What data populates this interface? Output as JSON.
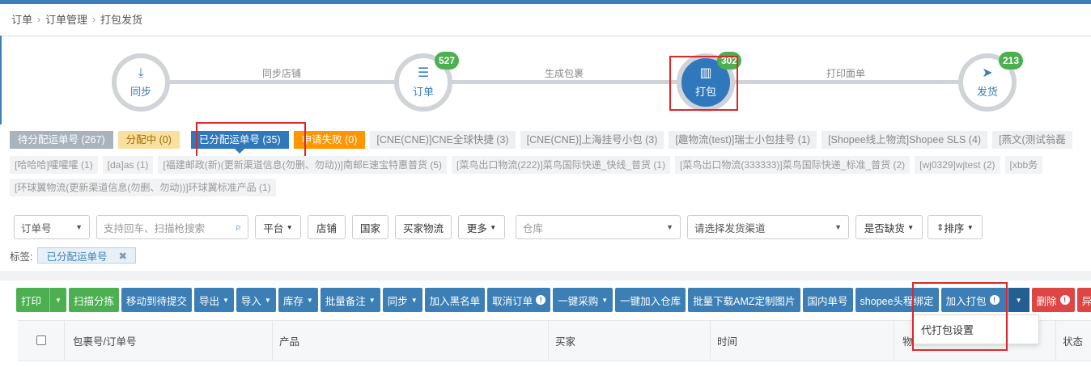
{
  "breadcrumb": [
    "订单",
    "订单管理",
    "打包发货"
  ],
  "steps": [
    {
      "label": "同步",
      "icon": "download-icon",
      "badge": ""
    },
    {
      "label": "订单",
      "icon": "list-icon",
      "badge": "527"
    },
    {
      "label": "打包",
      "icon": "barcode-icon",
      "badge": "302"
    },
    {
      "label": "发货",
      "icon": "paper-plane-icon",
      "badge": "213"
    }
  ],
  "step_connectors": [
    "同步店铺",
    "生成包裹",
    "打印面单"
  ],
  "status_tabs": [
    {
      "label": "待分配运单号 (267)",
      "style": "grey"
    },
    {
      "label": "分配中 (0)",
      "style": "yellow"
    },
    {
      "label": "已分配运单号 (35)",
      "style": "blue"
    },
    {
      "label": "申请失败 (0)",
      "style": "orange"
    }
  ],
  "channel_tags_row1": [
    "[CNE(CNE)]CNE全球快捷 (3)",
    "[CNE(CNE)]上海挂号小包 (3)",
    "[趣物流(test)]瑞士小包挂号 (1)",
    "[Shopee线上物流]Shopee SLS (4)",
    "[燕文(测试翁磊"
  ],
  "channel_tags_row2": [
    "[哈哈哈]嚯嚯嚯 (1)",
    "[da]as (1)",
    "[福建邮政(新)(更新渠道信息(勿删、勿动))]南邮E速宝特惠普货 (5)",
    "[菜鸟出口物流(222)]菜鸟国际快递_快线_普货 (1)",
    "[菜鸟出口物流(333333)]菜鸟国际快递_标准_普货 (2)",
    "[wj0329]wjtest (2)",
    "[xbb务"
  ],
  "channel_tags_row3": [
    "[环球翼物流(更新渠道信息(勿删、勿动))]环球翼标准产品 (1)"
  ],
  "filters": {
    "order_type": "订单号",
    "search_placeholder": "支持回车、扫描枪搜索",
    "platform": "平台",
    "shop": "店铺",
    "country": "国家",
    "buyer_logistics": "买家物流",
    "more": "更多",
    "warehouse_placeholder": "仓库",
    "channel_placeholder": "请选择发货渠道",
    "stock": "是否缺货",
    "sort": "排序"
  },
  "tag_label": "标签:",
  "active_tag": "已分配运单号",
  "toolbar": {
    "print": "打印",
    "scan_sort": "扫描分拣",
    "move_pending": "移动到待提交",
    "export": "导出",
    "import": "导入",
    "stock": "库存",
    "batch_note": "批量备注",
    "sync": "同步",
    "blacklist": "加入黑名单",
    "cancel_order": "取消订单",
    "one_click_purchase": "一键采购",
    "add_warehouse": "一键加入仓库",
    "download_amz": "批量下载AMZ定制图片",
    "domestic_no": "国内单号",
    "shopee_bind": "shopee头程绑定",
    "add_pack": "加入打包",
    "delete": "删除",
    "abnormal": "异常标记"
  },
  "dropdown_item": "代打包设置",
  "table_headers": [
    "包裹号/订单号",
    "产品",
    "买家",
    "时间",
    "物",
    "状态"
  ],
  "colors": {
    "accent": "#2f78bb",
    "success": "#4caf50",
    "danger": "#e04545",
    "warning": "#ff9500"
  }
}
